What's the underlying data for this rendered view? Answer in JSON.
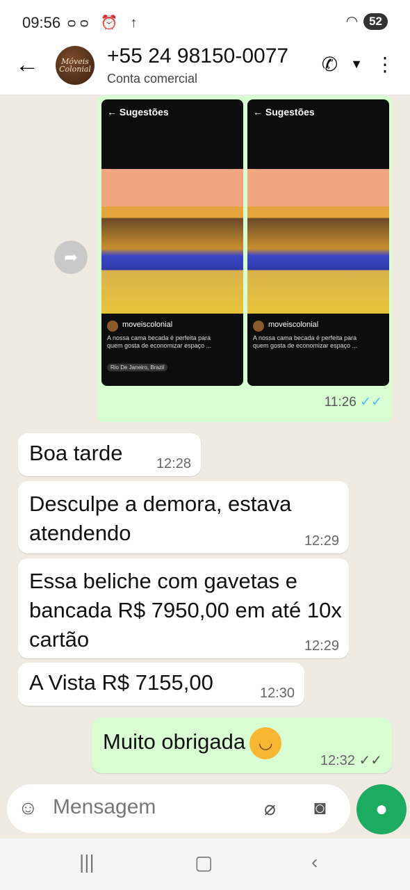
{
  "status_bar": {
    "time": "09:56",
    "icons": "ᴑᴑ ⏰ ↑",
    "battery": "52"
  },
  "header": {
    "name": "+55 24 98150-0077",
    "subtitle": "Conta comercial",
    "avatar_text": "Móveis Colonial"
  },
  "image_message": {
    "shots": [
      {
        "title": "Sugestões",
        "account": "moveiscolonial",
        "caption": "A nossa cama becada é perfeita para quem gosta de economizar espaço ...",
        "location": "Rio De Janeiro, Brazil"
      },
      {
        "title": "Sugestões",
        "account": "moveiscolonial",
        "caption": "A nossa cama becada é perfeita para quem gosta de economizar espaço ...",
        "location": ""
      }
    ],
    "time": "11:26"
  },
  "messages": [
    {
      "text": "Boa tarde",
      "time": "12:28",
      "direction": "in"
    },
    {
      "text": "Desculpe a demora, estava atendendo",
      "time": "12:29",
      "direction": "in"
    },
    {
      "text": "Essa beliche com gavetas e bancada R$ 7950,00 em até 10x cartão",
      "time": "12:29",
      "direction": "in"
    },
    {
      "text": "A Vista R$ 7155,00",
      "time": "12:30",
      "direction": "in"
    },
    {
      "text": "Muito obrigada",
      "time": "12:32",
      "direction": "out"
    }
  ],
  "input": {
    "placeholder": "Mensagem"
  },
  "colors": {
    "outgoing_bubble": "#d9fdd3",
    "incoming_bubble": "#ffffff",
    "chat_background": "#efeae2",
    "mic_button": "#1daa61",
    "read_ticks": "#53bdeb"
  }
}
